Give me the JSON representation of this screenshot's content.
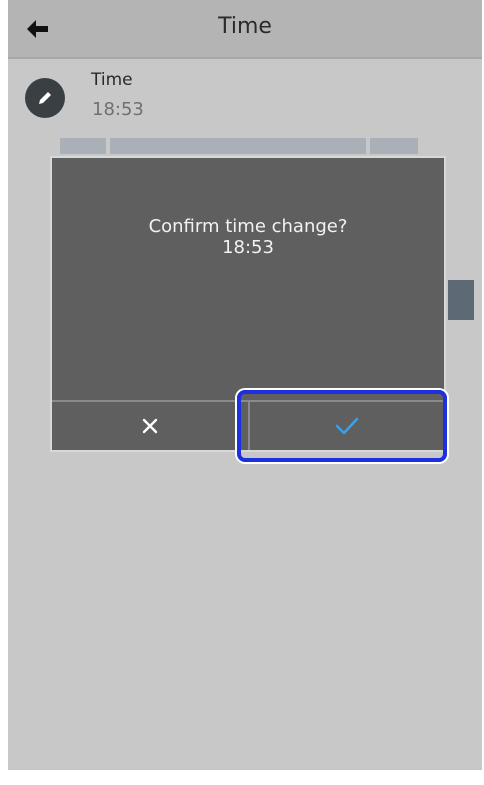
{
  "header": {
    "title": "Time",
    "back_icon": "back-arrow-icon"
  },
  "setting": {
    "label": "Time",
    "value": "18:53",
    "icon": "edit-pencil-icon"
  },
  "dialog": {
    "message_line1": "Confirm time change?",
    "message_line2": "18:53",
    "cancel_icon": "close-icon",
    "confirm_icon": "checkmark-icon"
  },
  "colors": {
    "highlight": "#1d2fe0",
    "check": "#3aa0e8",
    "dialog_bg": "#5f5f5f",
    "screen_bg": "#c8c8c8"
  }
}
